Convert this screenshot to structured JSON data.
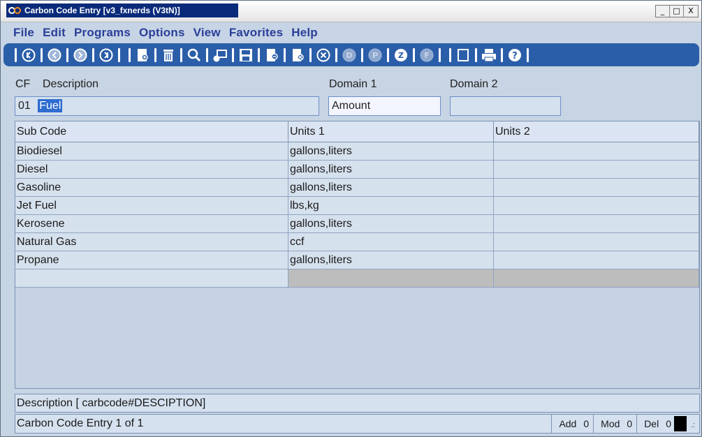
{
  "window": {
    "title": "Carbon Code Entry [v3_fxnerds (V3tN)]",
    "controls": [
      "_",
      "□",
      "X"
    ]
  },
  "menu": [
    "File",
    "Edit",
    "Programs",
    "Options",
    "View",
    "Favorites",
    "Help"
  ],
  "toolbar": {
    "color": "#2b5ea9",
    "icons": [
      "first-record-icon",
      "previous-record-icon",
      "next-record-icon",
      "last-record-icon",
      "new-record-icon",
      "delete-icon",
      "search-icon",
      "lookup-icon",
      "save-icon",
      "copy-icon",
      "void-icon",
      "cancel-icon",
      "d-icon",
      "p-icon",
      "z-icon",
      "f-icon",
      "report-icon",
      "print-icon",
      "help-icon"
    ]
  },
  "header": {
    "cf_label": "CF",
    "description_label": "Description",
    "domain1_label": "Domain 1",
    "domain2_label": "Domain 2",
    "cf_value": "01",
    "description_value": "Fuel",
    "domain1_value": "Amount",
    "domain2_value": ""
  },
  "grid": {
    "columns": [
      "Sub Code",
      "Units 1",
      "Units 2"
    ],
    "rows": [
      [
        "Biodiesel",
        "gallons,liters",
        ""
      ],
      [
        "Diesel",
        "gallons,liters",
        ""
      ],
      [
        "Gasoline",
        "gallons,liters",
        ""
      ],
      [
        "Jet Fuel",
        "lbs,kg",
        ""
      ],
      [
        "Kerosene",
        "gallons,liters",
        ""
      ],
      [
        "Natural Gas",
        "ccf",
        ""
      ],
      [
        "Propane",
        "gallons,liters",
        ""
      ],
      [
        "",
        "",
        ""
      ]
    ]
  },
  "status": {
    "field_hint": "Description [ carbcode#DESCIPTION]",
    "record_info": "Carbon Code Entry 1 of 1",
    "add_label": "Add",
    "add_count": "0",
    "mod_label": "Mod",
    "mod_count": "0",
    "del_label": "Del",
    "del_count": "0",
    "grip": ".:"
  }
}
